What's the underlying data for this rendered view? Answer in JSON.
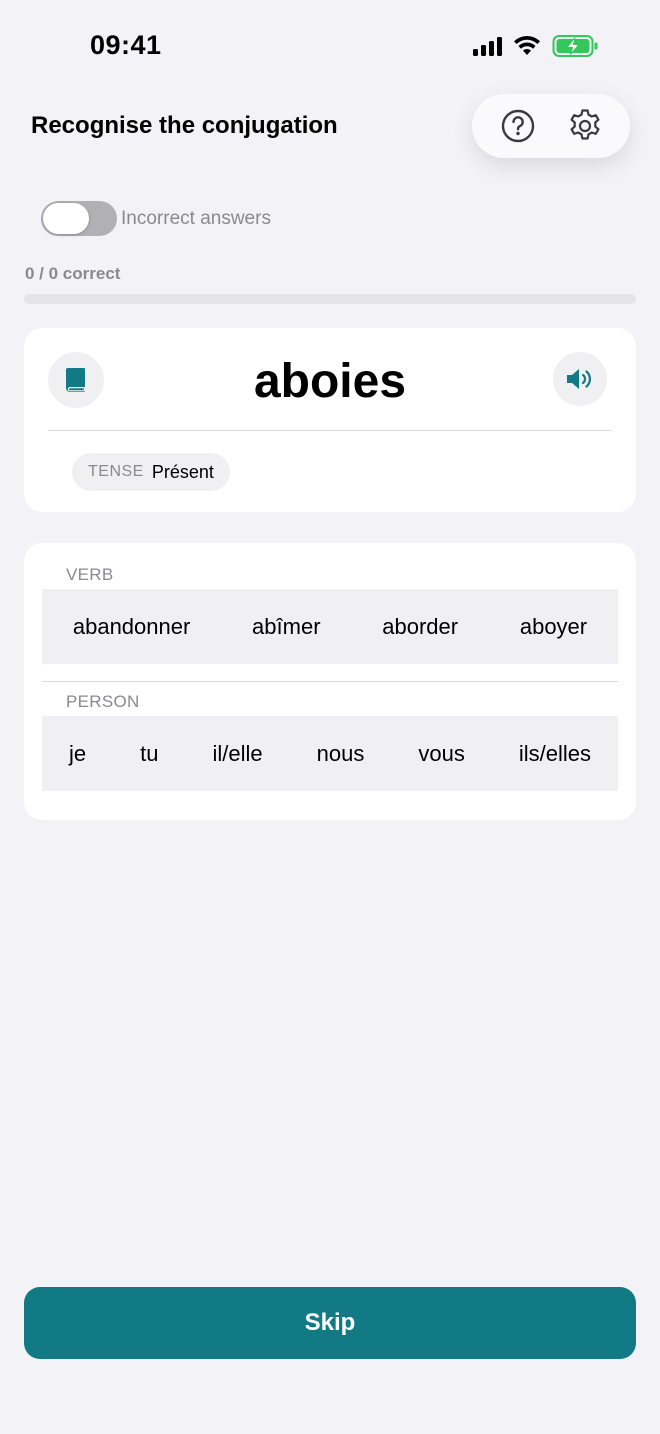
{
  "status_bar": {
    "time": "09:41"
  },
  "header": {
    "title": "Recognise the conjugation",
    "help_icon": "question-circle-icon",
    "settings_icon": "gear-icon"
  },
  "filter": {
    "toggle_label": "Incorrect answers",
    "toggle_on": false
  },
  "progress": {
    "text": "0 / 0 correct",
    "fraction": 0
  },
  "word_card": {
    "word": "aboies",
    "book_icon": "book-icon",
    "audio_icon": "speaker-icon",
    "tense_key": "TENSE",
    "tense_value": "Présent"
  },
  "verb_section": {
    "label": "VERB",
    "options": [
      "abandonner",
      "abîmer",
      "aborder",
      "aboyer"
    ]
  },
  "person_section": {
    "label": "PERSON",
    "options": [
      "je",
      "tu",
      "il/elle",
      "nous",
      "vous",
      "ils/elles"
    ]
  },
  "footer": {
    "skip_label": "Skip"
  },
  "colors": {
    "accent": "#117a84",
    "background": "#f2f2f7",
    "battery_green": "#34c759"
  }
}
